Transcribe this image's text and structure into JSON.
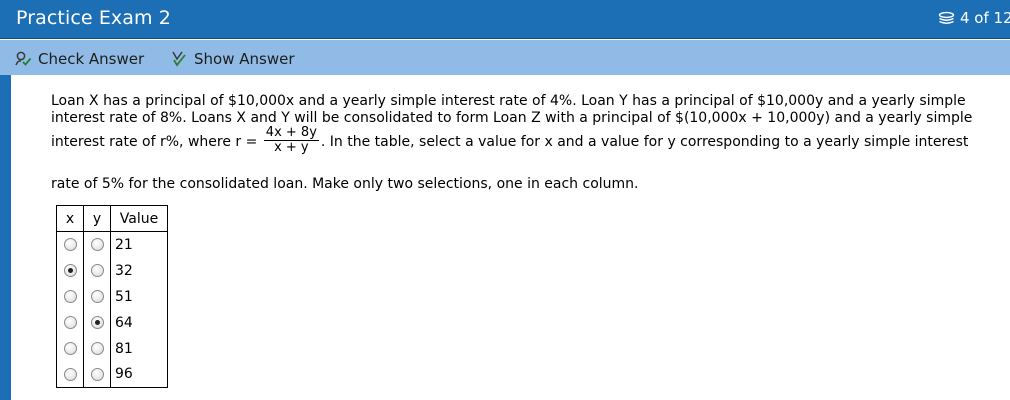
{
  "app": {
    "title": "Practice Exam 2"
  },
  "page_counter": {
    "label": "4 of 12",
    "icon": "stack-icon"
  },
  "toolbar": {
    "check_answer": {
      "label": "Check Answer",
      "icon": "check-answer-icon"
    },
    "show_answer": {
      "label": "Show Answer",
      "icon": "show-answer-icon"
    }
  },
  "question": {
    "line1": "Loan X has a principal of $10,000x and a yearly simple interest rate of 4%. Loan Y has a principal of $10,000y and a yearly simple",
    "line2": "interest rate of 8%. Loans X and Y will be consolidated to form Loan Z with a principal of $(10,000x + 10,000y) and a yearly simple",
    "line3_before": "interest rate of r%, where r = ",
    "fraction_numerator": "4x + 8y",
    "fraction_denominator": "x + y",
    "line3_after": ". In the table, select a value for x and a value for y corresponding to a yearly simple interest",
    "line4": "rate of 5% for the consolidated loan. Make only two selections, one in each column."
  },
  "table": {
    "headers": {
      "x": "x",
      "y": "y",
      "value": "Value"
    },
    "rows": [
      {
        "value": "21",
        "x_selected": false,
        "y_selected": false
      },
      {
        "value": "32",
        "x_selected": true,
        "y_selected": false
      },
      {
        "value": "51",
        "x_selected": false,
        "y_selected": false
      },
      {
        "value": "64",
        "x_selected": false,
        "y_selected": true
      },
      {
        "value": "81",
        "x_selected": false,
        "y_selected": false
      },
      {
        "value": "96",
        "x_selected": false,
        "y_selected": false
      }
    ]
  },
  "colors": {
    "titlebar": "#1c6fb5",
    "toolbar": "#8fbbe6"
  }
}
